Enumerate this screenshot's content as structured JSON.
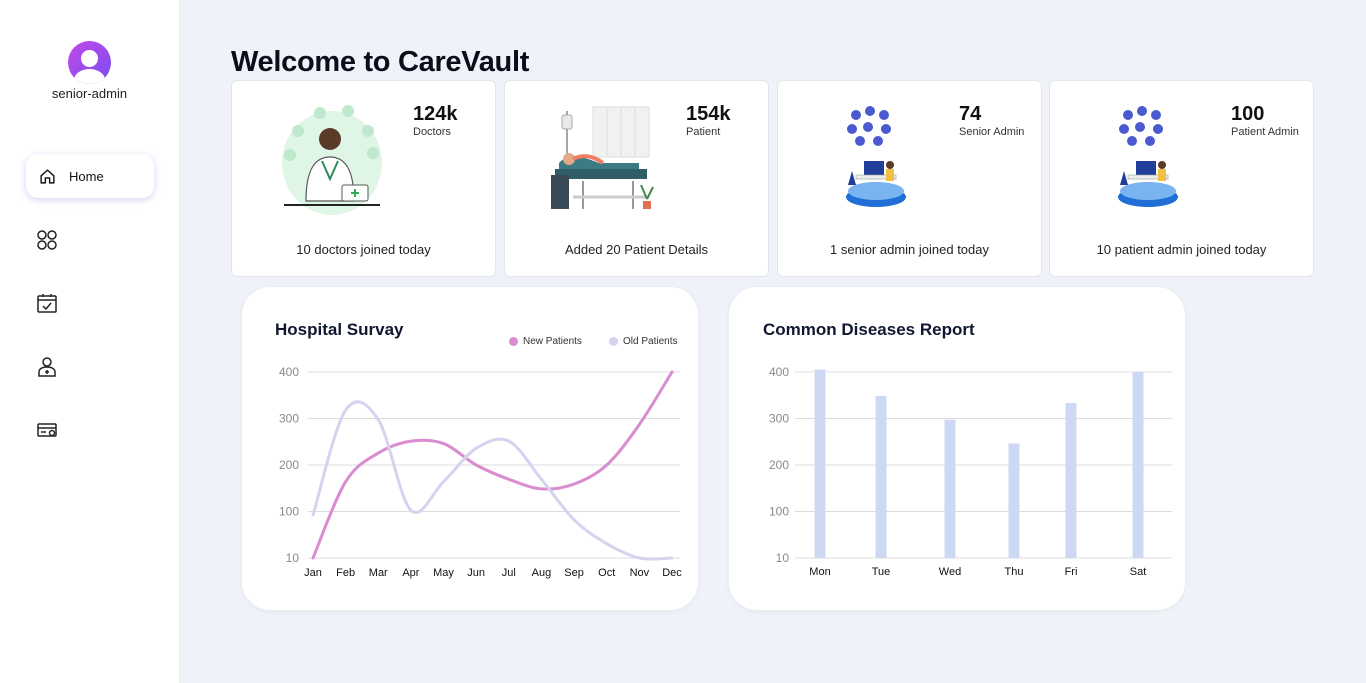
{
  "sidebar": {
    "user_name": "senior-admin",
    "home_label": "Home",
    "icons": [
      "grid-icon",
      "calendar-check-icon",
      "doctor-icon",
      "card-icon"
    ]
  },
  "welcome_title": "Welcome to CareVault",
  "stats": [
    {
      "count": "124k",
      "label": "Doctors",
      "footer": "10 doctors joined today"
    },
    {
      "count": "154k",
      "label": "Patient",
      "footer": "Added 20 Patient Details"
    },
    {
      "count": "74",
      "label": "Senior Admin",
      "footer": "1 senior admin joined today"
    },
    {
      "count": "100",
      "label": "Patient Admin",
      "footer": "10 patient admin joined today"
    }
  ],
  "colors": {
    "accent": "#7a4df0",
    "new_patients": "#d98cd0",
    "old_patients": "#d7d2f0",
    "bars": "#cdd8f2"
  },
  "chart_data": [
    {
      "type": "line",
      "title": "Hospital Survay",
      "categories": [
        "Jan",
        "Feb",
        "Mar",
        "Apr",
        "May",
        "Jun",
        "Jul",
        "Aug",
        "Sep",
        "Oct",
        "Nov",
        "Dec"
      ],
      "yticks": [
        "400",
        "300",
        "200",
        "100",
        "10"
      ],
      "ylim": [
        10,
        400
      ],
      "grid": true,
      "legend": "top-right",
      "series": [
        {
          "name": "New Patients",
          "values": [
            10,
            170,
            230,
            255,
            250,
            205,
            175,
            155,
            165,
            205,
            290,
            400
          ]
        },
        {
          "name": "Old Patients",
          "values": [
            100,
            320,
            300,
            110,
            170,
            240,
            255,
            175,
            90,
            40,
            10,
            10
          ]
        }
      ]
    },
    {
      "type": "bar",
      "title": "Common Diseases Report",
      "categories": [
        "Mon",
        "Tue",
        "Wed",
        "Thu",
        "Fri",
        "Sat"
      ],
      "values": [
        405,
        350,
        300,
        250,
        335,
        400
      ],
      "yticks": [
        "400",
        "300",
        "200",
        "100",
        "10"
      ],
      "ylim": [
        10,
        400
      ],
      "grid": true
    }
  ]
}
